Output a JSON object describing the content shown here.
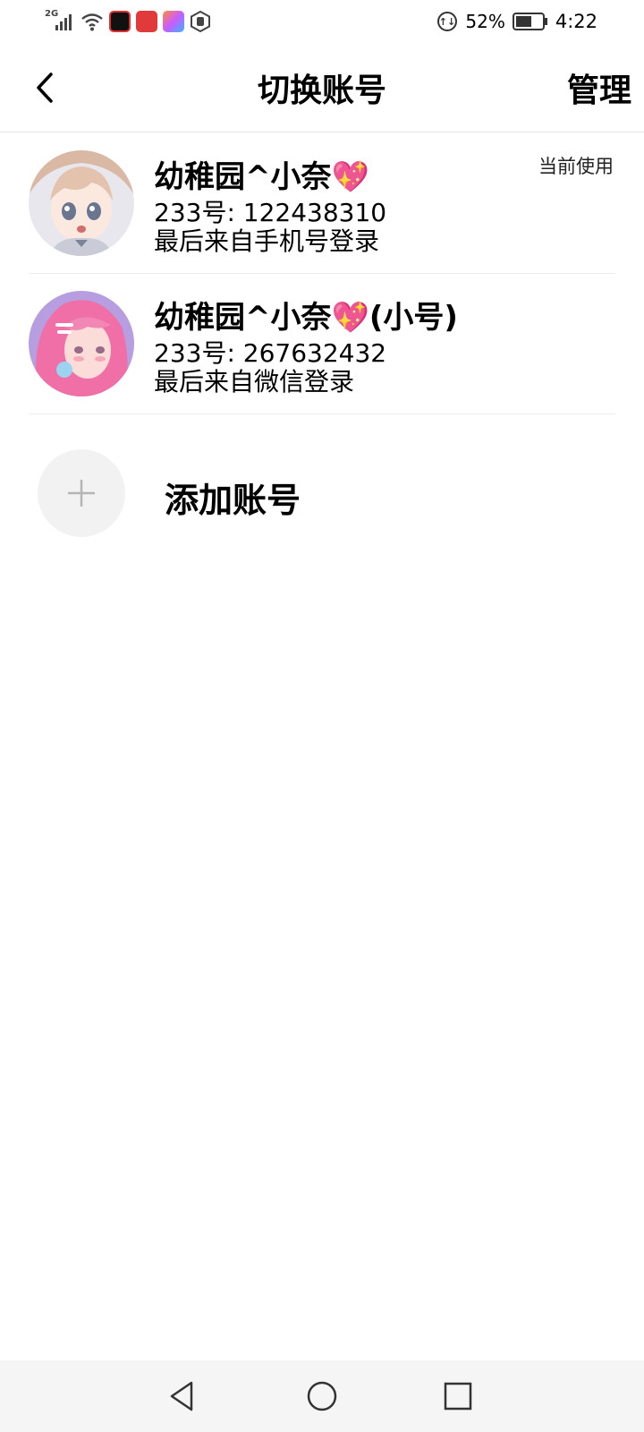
{
  "status_bar": {
    "network": "2G",
    "battery_percent": "52%",
    "time": "4:22",
    "icons": [
      "signal-icon",
      "wifi-icon",
      "app-icon-1",
      "app-icon-2",
      "app-icon-3",
      "hand-icon",
      "data-saver-icon",
      "battery-icon"
    ]
  },
  "header": {
    "title": "切换账号",
    "manage_label": "管理",
    "back_icon": "back-chevron-icon"
  },
  "accounts": [
    {
      "name": "幼稚园^小奈💖",
      "id_line": "233号: 122438310",
      "login_line": "最后来自手机号登录",
      "current_tag": "当前使用"
    },
    {
      "name": "幼稚园^小奈💖(小号)",
      "id_line": "233号: 267632432",
      "login_line": "最后来自微信登录"
    }
  ],
  "add_account": {
    "label": "添加账号",
    "icon": "plus-icon"
  },
  "nav_bar": {
    "icons": [
      "back-triangle-icon",
      "home-circle-icon",
      "recents-square-icon"
    ]
  }
}
